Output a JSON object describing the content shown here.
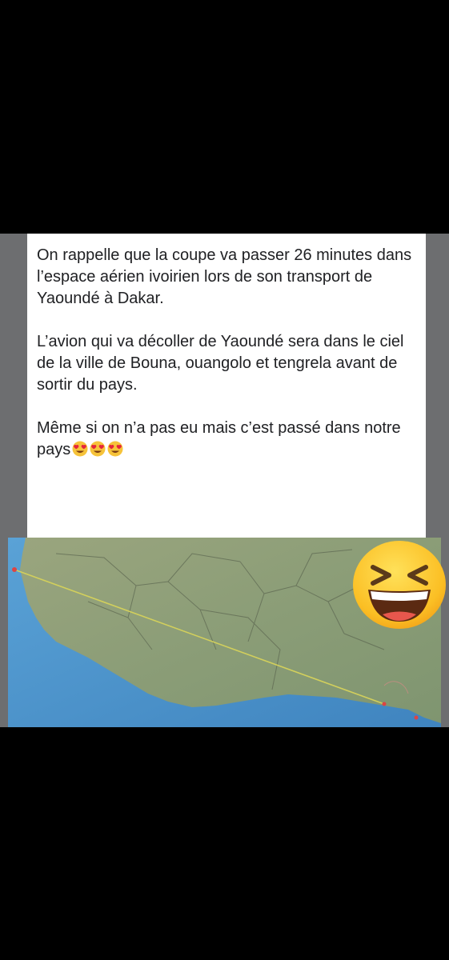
{
  "post": {
    "paragraphs": [
      "On rappelle que la coupe va passer 26 minutes dans l’espace aérien ivoirien lors de son transport de Yaoundé à Dakar.",
      "L’avion qui va décoller de Yaoundé sera dans le ciel de la ville de Bouna, ouangolo et tengrela avant de sortir du pays.",
      "Même si on n’a pas eu mais c’est passé dans notre pays"
    ],
    "emoji_names": [
      "heart-eyes-emoji",
      "heart-eyes-emoji",
      "heart-eyes-emoji"
    ]
  },
  "map": {
    "description_icon": "map-image",
    "route_color": "#c9c85a",
    "land_color": "#8f9f78",
    "sea_color": "#4a90c8"
  },
  "overlay": {
    "emoji_name": "laughing-squint-emoji"
  }
}
